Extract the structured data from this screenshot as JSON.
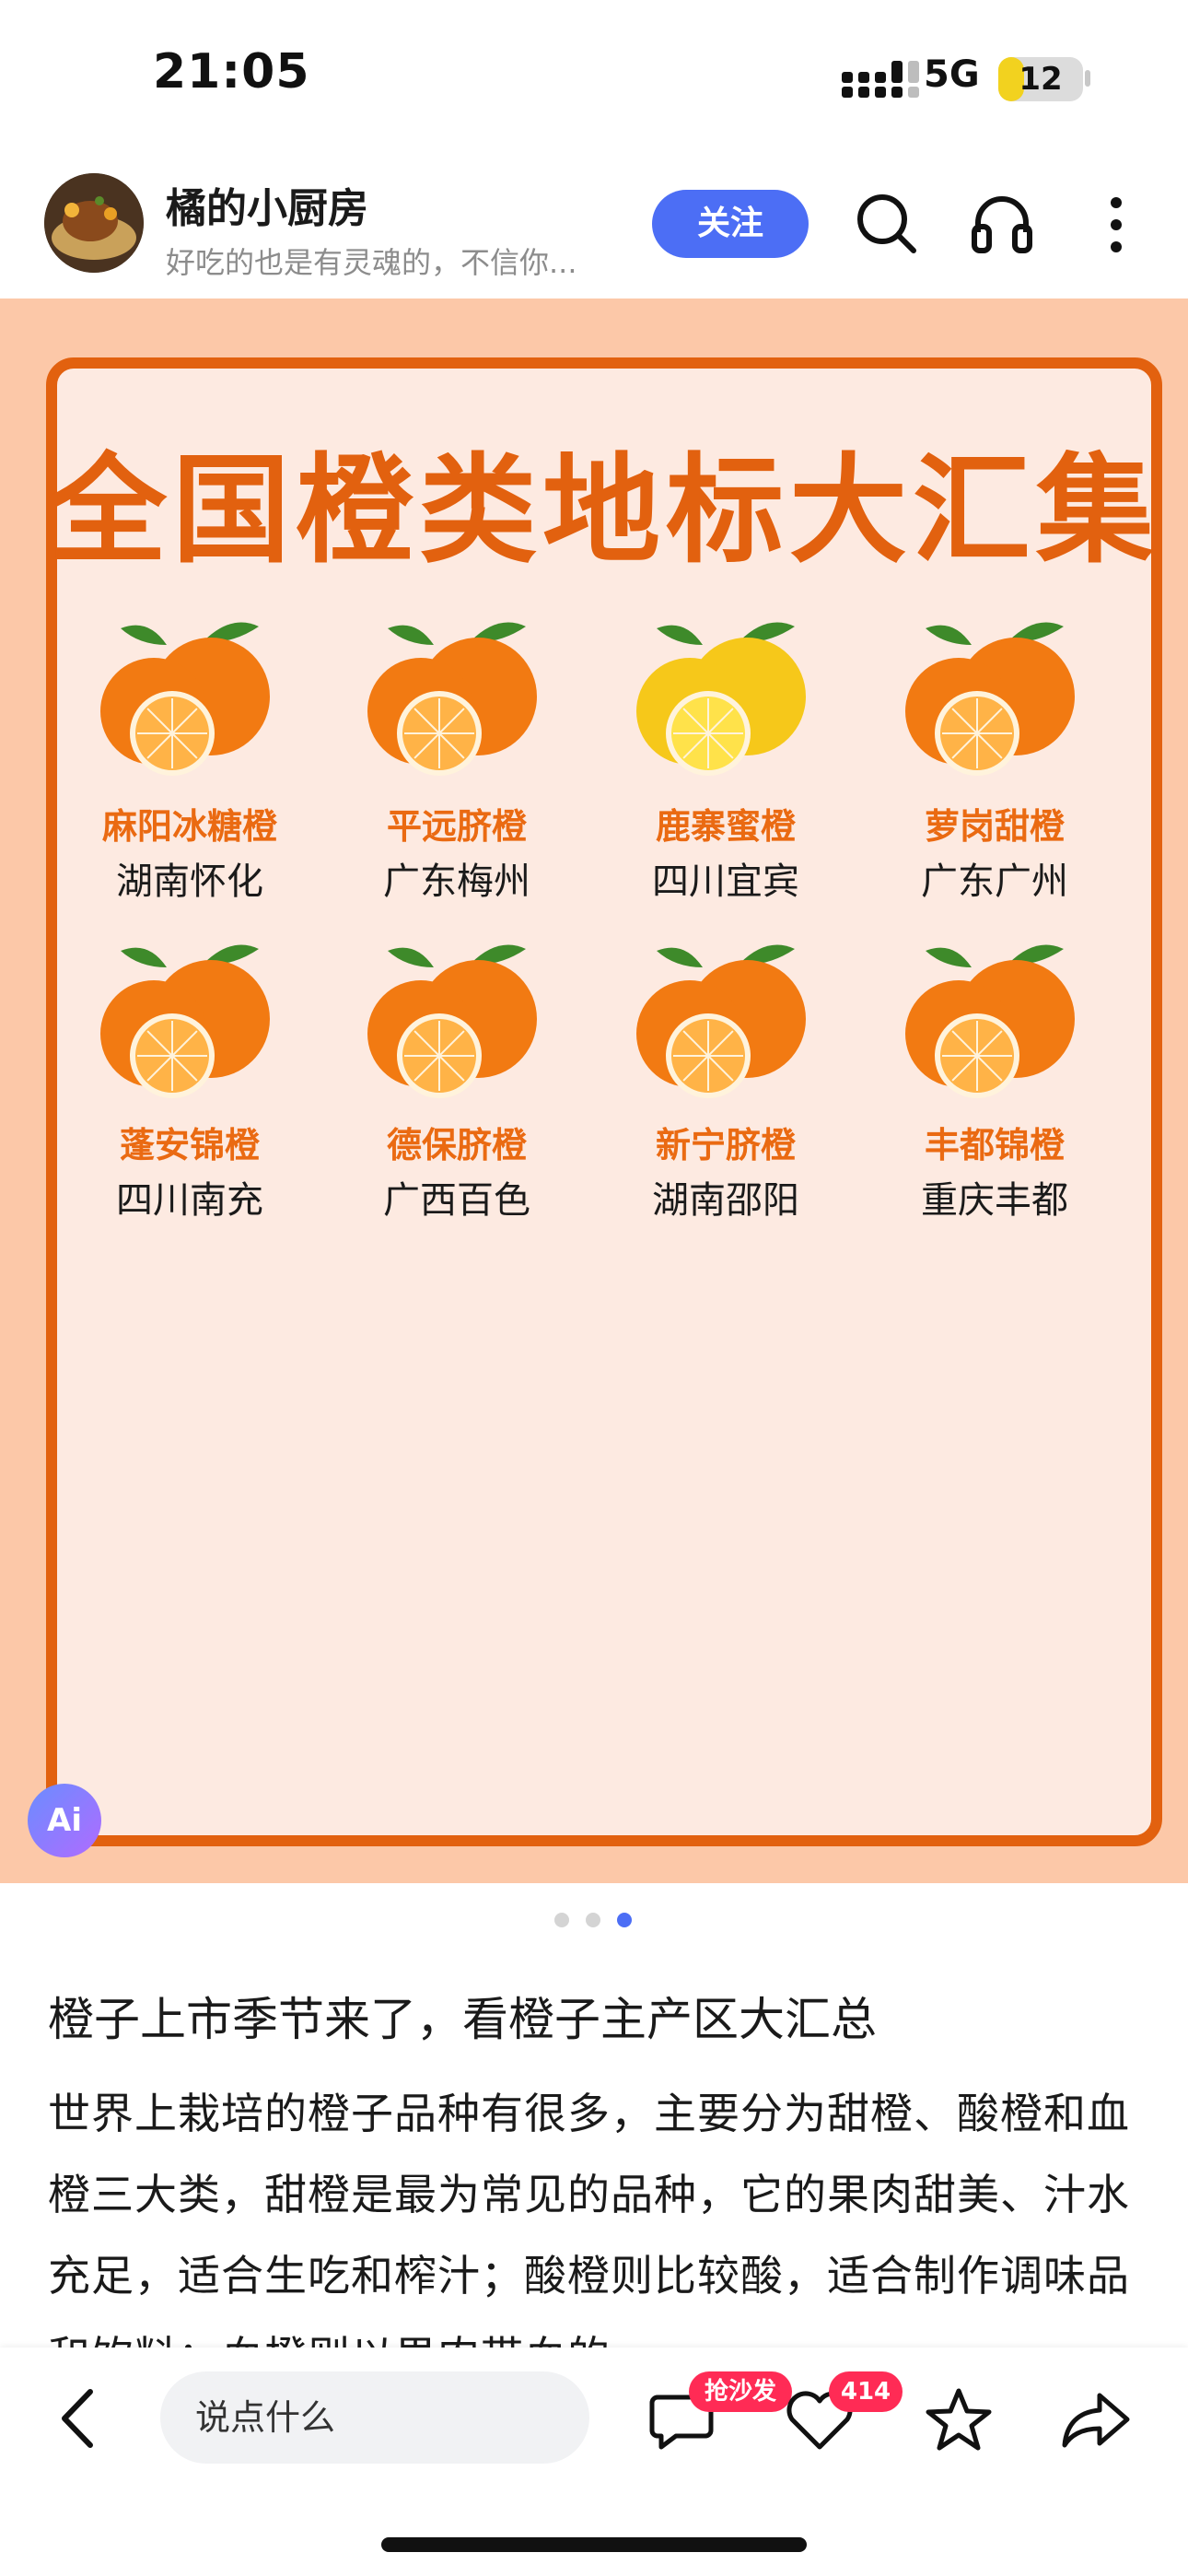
{
  "status_bar": {
    "time": "21:05",
    "network": "5G",
    "battery": "12",
    "battery_level": 0.12
  },
  "header": {
    "author_name": "橘的小厨房",
    "author_bio": "好吃的也是有灵魂的，不信你...",
    "follow_label": "关注",
    "icons": [
      "search-icon",
      "headphones-icon",
      "more-icon"
    ]
  },
  "poster": {
    "title": "全国橙类地标大汇集",
    "items": [
      {
        "name": "麻阳冰糖橙",
        "place": "湖南怀化"
      },
      {
        "name": "平远脐橙",
        "place": "广东梅州"
      },
      {
        "name": "鹿寨蜜橙",
        "place": "四川宜宾"
      },
      {
        "name": "萝岗甜橙",
        "place": "广东广州"
      },
      {
        "name": "蓬安锦橙",
        "place": "四川南充"
      },
      {
        "name": "德保脐橙",
        "place": "广西百色"
      },
      {
        "name": "新宁脐橙",
        "place": "湖南邵阳"
      },
      {
        "name": "丰都锦橙",
        "place": "重庆丰都"
      }
    ],
    "ai_badge": "Ai",
    "colors": {
      "accent": "#e2610f",
      "background": "#fcc8a8",
      "panel": "#fdeae1"
    }
  },
  "carousel": {
    "total": 3,
    "active_index": 2
  },
  "article": {
    "title": "橙子上市季节来了，看橙子主产区大汇总",
    "body": "世界上栽培的橙子品种有很多，主要分为甜橙、酸橙和血橙三大类，甜橙是最为常见的品种，它的果肉甜美、汁水充足，适合生吃和榨汁；酸橙则比较酸，适合制作调味品和饮料；血橙则以果肉带血的"
  },
  "bottom_bar": {
    "comment_placeholder": "说点什么",
    "comment_badge": "抢沙发",
    "like_count": "414",
    "accent": "#ff2b55"
  }
}
